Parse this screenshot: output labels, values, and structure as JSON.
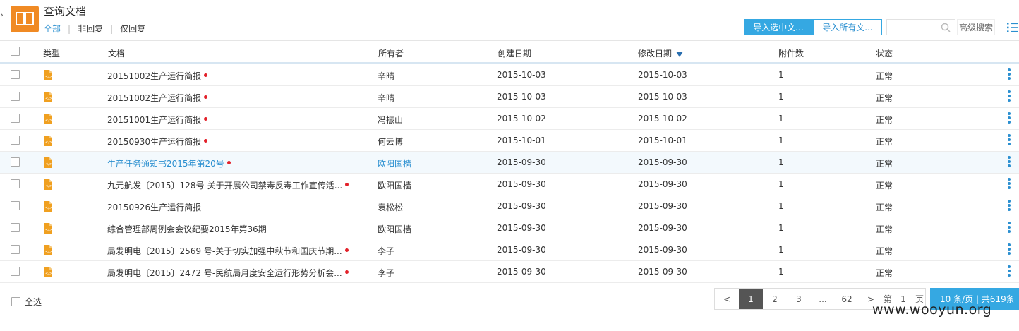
{
  "header": {
    "title": "查询文档",
    "filters": [
      "全部",
      "非回复",
      "仅回复"
    ],
    "active_filter_index": 0,
    "import_selected_label": "导入选中文...",
    "import_all_label": "导入所有文...",
    "search_placeholder": "",
    "advanced_search_label": "高级搜索"
  },
  "table": {
    "columns": {
      "type": "类型",
      "document": "文档",
      "owner": "所有者",
      "created": "创建日期",
      "modified": "修改日期",
      "attachments": "附件数",
      "status": "状态"
    },
    "rows": [
      {
        "document": "20151002生产运行简报",
        "unread": true,
        "owner": "辛晴",
        "created": "2015-10-03",
        "modified": "2015-10-03",
        "attachments": "1",
        "status": "正常"
      },
      {
        "document": "20151002生产运行简报",
        "unread": true,
        "owner": "辛晴",
        "created": "2015-10-03",
        "modified": "2015-10-03",
        "attachments": "1",
        "status": "正常"
      },
      {
        "document": "20151001生产运行简报",
        "unread": true,
        "owner": "冯振山",
        "created": "2015-10-02",
        "modified": "2015-10-02",
        "attachments": "1",
        "status": "正常"
      },
      {
        "document": "20150930生产运行简报",
        "unread": true,
        "owner": "何云博",
        "created": "2015-10-01",
        "modified": "2015-10-01",
        "attachments": "1",
        "status": "正常"
      },
      {
        "document": "生产任务通知书2015年第20号",
        "unread": true,
        "owner": "欧阳国樯",
        "created": "2015-09-30",
        "modified": "2015-09-30",
        "attachments": "1",
        "status": "正常"
      },
      {
        "document": "九元航发〔2015〕128号-关于开展公司禁毒反毒工作宣传活...",
        "unread": true,
        "owner": "欧阳国樯",
        "created": "2015-09-30",
        "modified": "2015-09-30",
        "attachments": "1",
        "status": "正常"
      },
      {
        "document": "20150926生产运行简报",
        "unread": false,
        "owner": "袁松松",
        "created": "2015-09-30",
        "modified": "2015-09-30",
        "attachments": "1",
        "status": "正常"
      },
      {
        "document": "综合管理部周例会会议纪要2015年第36期",
        "unread": false,
        "owner": "欧阳国樯",
        "created": "2015-09-30",
        "modified": "2015-09-30",
        "attachments": "1",
        "status": "正常"
      },
      {
        "document": "局发明电〔2015〕2569 号-关于切实加强中秋节和国庆节期...",
        "unread": true,
        "owner": "李子",
        "created": "2015-09-30",
        "modified": "2015-09-30",
        "attachments": "1",
        "status": "正常"
      },
      {
        "document": "局发明电〔2015〕2472 号-民航局月度安全运行形势分析会...",
        "unread": true,
        "owner": "李子",
        "created": "2015-09-30",
        "modified": "2015-09-30",
        "attachments": "1",
        "status": "正常"
      }
    ],
    "highlighted_row_index": 4
  },
  "footer": {
    "select_all_label": "全选",
    "pagination": {
      "prev": "<",
      "pages": [
        "1",
        "2",
        "3",
        "...",
        "62"
      ],
      "current": "1",
      "next": ">",
      "goto_prefix": "第",
      "goto_value": "1",
      "goto_suffix": "页",
      "page_size_label": "10  条/页 | 共619条"
    }
  },
  "watermark": "www.wooyun.org",
  "colors": {
    "accent": "#35a8e2",
    "app_icon": "#f08a24",
    "unread_dot": "#e3212a",
    "link": "#2a8fd0"
  }
}
